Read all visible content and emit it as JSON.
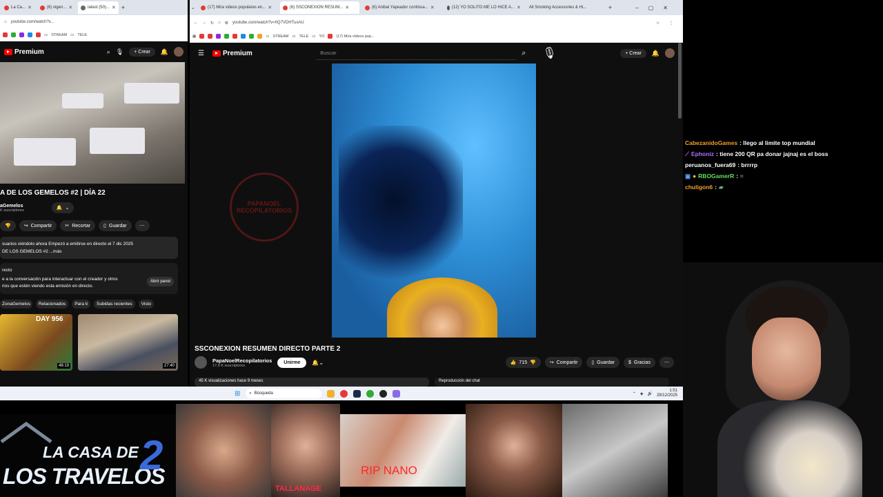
{
  "left_browser": {
    "tabs": [
      "La Ca...",
      "(6) vigen...",
      "latest (50)..."
    ],
    "url": "youtube.com/watch?v...",
    "bookmarks": [
      "STREAM",
      "TELE"
    ],
    "logo": "Premium",
    "create_label": "Crear",
    "notif_count": "6",
    "video_title": "A DE LOS GEMELOS #2 | DÍA 22",
    "channel": "aGemelos",
    "subscribers": "K suscriptores",
    "actions": [
      "Compartir",
      "Recortar",
      "Guardar"
    ],
    "desc_line1": "suarios viéndolo ahora  Empezó a emitirse en directo el 7 dic 2025",
    "desc_line2": "DE LOS GEMELOS #2 ...más",
    "chat_heading": "recto",
    "chat_text1": "e a la conversación para interactuar con el creador y otros",
    "chat_text2": "rios que estén viendo esta emisión en directo.",
    "open_panel": "Abrir panel",
    "filter_chips": [
      "ZonaGemelos",
      "Relacionados",
      "Para ti",
      "Subidas recientes",
      "Visto"
    ],
    "thumb1_text": "DAY 956",
    "thumb1_time": "48:19",
    "thumb2_time": "27:40"
  },
  "main_browser": {
    "tabs": [
      "(17) Mira videos populares en...",
      "(6) SSCONEXION RESUM...",
      "(6) Anibal Yapeador continua...",
      "(12) YO SOLITO ME LO HICE A...",
      "All Smoking Accessories & Hi..."
    ],
    "url": "youtube.com/watch?v=hQ7VDHTuxAU",
    "bookmarks": [
      "STREAM",
      "TELE",
      "YO",
      "(17) Mira vídeos pop..."
    ],
    "logo": "Premium",
    "search_placeholder": "Buscar",
    "create_label": "Crear",
    "notif_count": "6",
    "watermark": "PAPANOEL RECOPILATORIOS",
    "video_title": "SSCONEXION RESUMEN DIRECTO PARTE 2",
    "channel": "PapaNoelRecopilatorios",
    "subscribers": "17,9 K suscriptores",
    "join_label": "Unirme",
    "likes": "715",
    "share_label": "Compartir",
    "save_label": "Guardar",
    "thanks_label": "Gracias",
    "views": "45 K visualizaciones  hace 9 meses",
    "chat_replay": "Reproducción del chat"
  },
  "stream_chat": [
    {
      "user": "CabezanidoGames",
      "color": "#f0a030",
      "msg": ": llego al limite top mundial"
    },
    {
      "user": "Ephoniz",
      "color": "#b070ff",
      "msg": ": tiene 200 QR pa donar jajnaj es el boss"
    },
    {
      "user": "peruanos_fuera69",
      "color": "#ffffff",
      "msg": ": brrrrp"
    },
    {
      "user": "RBOGamerR",
      "color": "#60e060",
      "msg": ":"
    },
    {
      "user": "chuligon6",
      "color": "#f0a030",
      "msg": ":"
    }
  ],
  "taskbar": {
    "search_placeholder": "Búsqueda",
    "time": "1:51",
    "date": "29/12/2025"
  },
  "overlay": {
    "banner_line1": "LA CASA DE",
    "banner_line2": "LOS TRAVELOS",
    "banner_num": "2",
    "caption1": "TALLANAGE",
    "caption2": "RIP NANO"
  }
}
